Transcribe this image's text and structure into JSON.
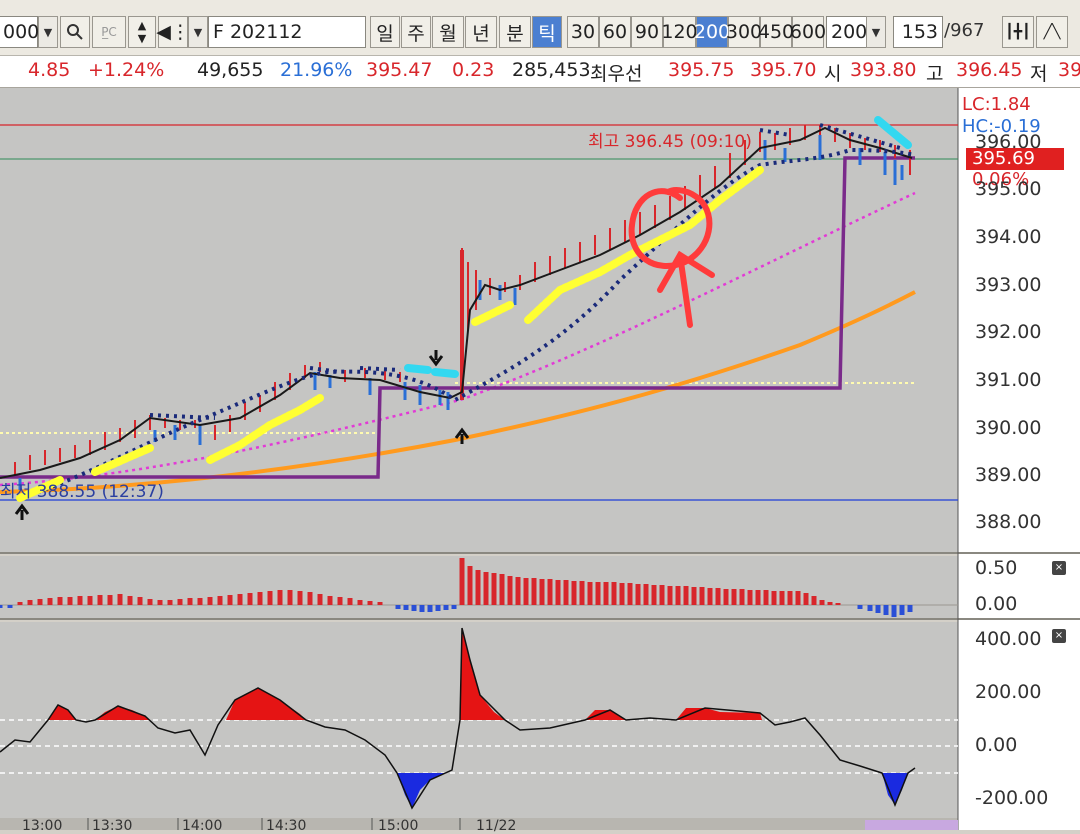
{
  "toolbar": {
    "code_fragment": "000",
    "futures_code": "F 202112",
    "period_buttons": [
      "일",
      "주",
      "월",
      "년",
      "분",
      "틱"
    ],
    "active_period": "틱",
    "tick_buttons": [
      "30",
      "60",
      "90",
      "120",
      "200",
      "300",
      "450",
      "600"
    ],
    "active_tick": "200",
    "count_select": "200",
    "page_current": "153",
    "page_total": "/967"
  },
  "quote": {
    "change": "4.85",
    "change_pct": "+1.24%",
    "volume": "49,655",
    "volume_pct": "21.96%",
    "price": "395.47",
    "price_diff": "0.23",
    "open_interest": "285,453",
    "best_label": "최우선",
    "best_ask": "395.75",
    "best_bid": "395.70",
    "open_label": "시",
    "open_value": "393.80",
    "high_label": "고",
    "high_value": "396.45",
    "low_label": "저",
    "low_value_fragment": "39"
  },
  "main_panel": {
    "lc_label": "LC:1.84",
    "hc_label": "HC:-0.19",
    "high_annotation": "최고 396.45 (09:10)",
    "low_annotation": "최저 388.55 (12:37)",
    "current_price_badge": "395.69",
    "current_change_badge": "0.06%",
    "y_ticks": [
      "396.00",
      "395.00",
      "394.00",
      "393.00",
      "392.00",
      "391.00",
      "390.00",
      "389.00",
      "388.00"
    ]
  },
  "panel2": {
    "y_ticks": [
      "0.50",
      "0.00"
    ]
  },
  "panel3": {
    "y_ticks": [
      "400.00",
      "200.00",
      "0.00",
      "-200.00"
    ]
  },
  "x_axis": {
    "ticks": [
      "13:00",
      "13:30",
      "14:00",
      "14:30",
      "15:00",
      "11/22"
    ]
  },
  "colors": {
    "up": "#d8262b",
    "down": "#2a6fd6",
    "highlight_yellow": "#ffff33",
    "highlight_cyan": "#33d8f0",
    "ma_orange": "#ff9a1e",
    "step_purple": "#7a2a8a",
    "dots_magenta": "#e23ad6",
    "ma_navy": "#1a2a7a",
    "annotation_red": "#ff3b3b"
  },
  "chart_data": {
    "type": "line",
    "x": [
      "13:00",
      "13:30",
      "14:00",
      "14:30",
      "15:00",
      "11/22"
    ],
    "series": [],
    "ylim": [
      387.5,
      396.8
    ],
    "high": 396.45,
    "low": 388.55,
    "current": 395.69
  }
}
